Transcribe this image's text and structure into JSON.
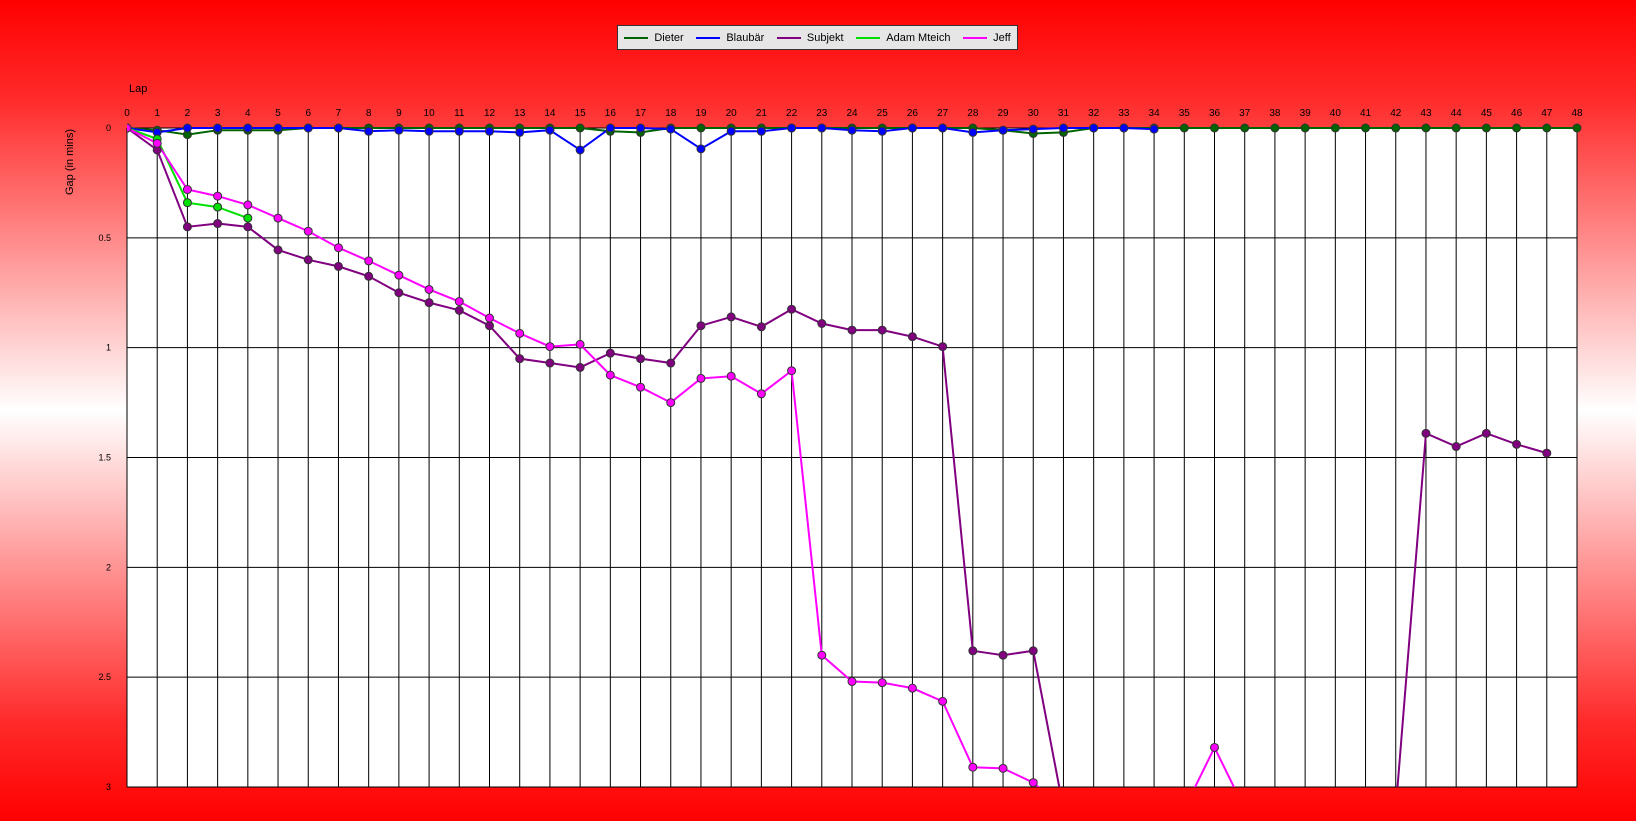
{
  "chart_data": {
    "type": "line",
    "title": "",
    "xlabel": "Lap",
    "ylabel": "Gap (in mins)",
    "x_ticks": [
      0,
      1,
      2,
      3,
      4,
      5,
      6,
      7,
      8,
      9,
      10,
      11,
      12,
      13,
      14,
      15,
      16,
      17,
      18,
      19,
      20,
      21,
      22,
      23,
      24,
      25,
      26,
      27,
      28,
      29,
      30,
      31,
      32,
      33,
      34,
      35,
      36,
      37,
      38,
      39,
      40,
      41,
      42,
      43,
      44,
      45,
      46,
      47,
      48
    ],
    "y_ticks": [
      "0",
      "0.5",
      "1",
      "1.5",
      "2",
      "2.5",
      "3"
    ],
    "xlim": [
      0,
      48
    ],
    "ylim": [
      0,
      3
    ],
    "y_inverted": true,
    "grid": true,
    "legend_position": "top-center",
    "series": [
      {
        "name": "Dieter",
        "color": "#006400",
        "x": [
          0,
          1,
          2,
          3,
          4,
          5,
          6,
          7,
          8,
          9,
          10,
          11,
          12,
          13,
          14,
          15,
          16,
          17,
          18,
          19,
          20,
          21,
          22,
          23,
          24,
          25,
          26,
          27,
          28,
          29,
          30,
          31,
          32,
          33,
          34,
          35,
          36,
          37,
          38,
          39,
          40,
          41,
          42,
          43,
          44,
          45,
          46,
          47,
          48
        ],
        "values": [
          0,
          0.01,
          0.03,
          0.01,
          0.01,
          0.01,
          0,
          0,
          0,
          0,
          0,
          0,
          0,
          0,
          0,
          0,
          0.015,
          0.02,
          0,
          0,
          0,
          0,
          0,
          0,
          0,
          0,
          0,
          0,
          0,
          0.01,
          0.025,
          0.02,
          0,
          0,
          0,
          0,
          0,
          0,
          0,
          0,
          0,
          0,
          0,
          0,
          0,
          0,
          0,
          0,
          0
        ]
      },
      {
        "name": "Blaubär",
        "color": "#0000ff",
        "x": [
          0,
          1,
          2,
          3,
          4,
          5,
          6,
          7,
          8,
          9,
          10,
          11,
          12,
          13,
          14,
          15,
          16,
          17,
          18,
          19,
          20,
          21,
          22,
          23,
          24,
          25,
          26,
          27,
          28,
          29,
          30,
          31,
          32,
          33,
          34
        ],
        "values": [
          0,
          0.02,
          0,
          0,
          0,
          0,
          0,
          0,
          0.015,
          0.01,
          0.015,
          0.015,
          0.015,
          0.02,
          0.01,
          0.1,
          0,
          0,
          0.005,
          0.095,
          0.015,
          0.015,
          0,
          0,
          0.01,
          0.015,
          0,
          0,
          0.02,
          0.01,
          0.005,
          0,
          0,
          0,
          0.005
        ]
      },
      {
        "name": "Subjekt",
        "color": "#800080",
        "x": [
          0,
          1,
          2,
          3,
          4,
          5,
          6,
          7,
          8,
          9,
          10,
          11,
          12,
          13,
          14,
          15,
          16,
          17,
          18,
          19,
          20,
          21,
          22,
          23,
          24,
          25,
          26,
          27,
          28,
          29,
          30,
          31,
          42,
          43,
          44,
          45,
          46,
          47
        ],
        "values": [
          0,
          0.1,
          0.45,
          0.435,
          0.45,
          0.555,
          0.6,
          0.63,
          0.675,
          0.75,
          0.795,
          0.83,
          0.9,
          1.05,
          1.07,
          1.09,
          1.025,
          1.05,
          1.07,
          0.9,
          0.86,
          0.905,
          0.825,
          0.89,
          0.92,
          0.92,
          0.95,
          0.995,
          2.38,
          2.4,
          2.38,
          3.1,
          3.1,
          1.39,
          1.45,
          1.39,
          1.44,
          1.48
        ]
      },
      {
        "name": "Adam Mteich",
        "color": "#00e000",
        "x": [
          0,
          1,
          2,
          3,
          4
        ],
        "values": [
          0,
          0.05,
          0.34,
          0.36,
          0.41
        ]
      },
      {
        "name": "Jeff",
        "color": "#ff00ff",
        "x": [
          0,
          1,
          2,
          3,
          4,
          5,
          6,
          7,
          8,
          9,
          10,
          11,
          12,
          13,
          14,
          15,
          16,
          17,
          18,
          19,
          20,
          21,
          22,
          23,
          24,
          25,
          26,
          27,
          28,
          29,
          30,
          31,
          35,
          36,
          37
        ],
        "values": [
          0,
          0.07,
          0.28,
          0.31,
          0.35,
          0.41,
          0.47,
          0.545,
          0.605,
          0.67,
          0.735,
          0.79,
          0.865,
          0.935,
          0.995,
          0.985,
          1.125,
          1.18,
          1.25,
          1.14,
          1.13,
          1.21,
          1.105,
          2.4,
          2.52,
          2.525,
          2.55,
          2.61,
          2.91,
          2.915,
          2.98,
          3.1,
          3.1,
          2.82,
          3.1
        ]
      }
    ]
  }
}
